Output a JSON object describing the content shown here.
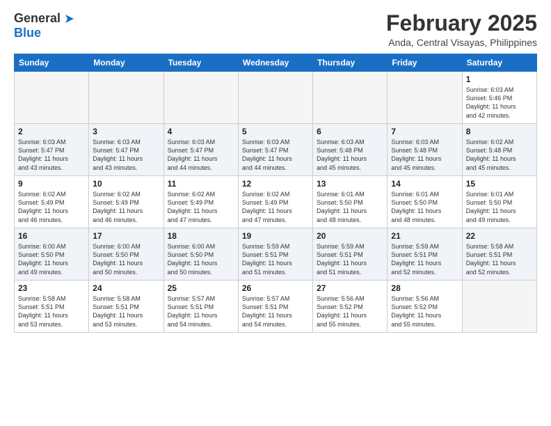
{
  "header": {
    "logo_general": "General",
    "logo_blue": "Blue",
    "month": "February 2025",
    "location": "Anda, Central Visayas, Philippines"
  },
  "weekdays": [
    "Sunday",
    "Monday",
    "Tuesday",
    "Wednesday",
    "Thursday",
    "Friday",
    "Saturday"
  ],
  "weeks": [
    [
      {
        "day": "",
        "info": ""
      },
      {
        "day": "",
        "info": ""
      },
      {
        "day": "",
        "info": ""
      },
      {
        "day": "",
        "info": ""
      },
      {
        "day": "",
        "info": ""
      },
      {
        "day": "",
        "info": ""
      },
      {
        "day": "1",
        "info": "Sunrise: 6:03 AM\nSunset: 5:46 PM\nDaylight: 11 hours\nand 42 minutes."
      }
    ],
    [
      {
        "day": "2",
        "info": "Sunrise: 6:03 AM\nSunset: 5:47 PM\nDaylight: 11 hours\nand 43 minutes."
      },
      {
        "day": "3",
        "info": "Sunrise: 6:03 AM\nSunset: 5:47 PM\nDaylight: 11 hours\nand 43 minutes."
      },
      {
        "day": "4",
        "info": "Sunrise: 6:03 AM\nSunset: 5:47 PM\nDaylight: 11 hours\nand 44 minutes."
      },
      {
        "day": "5",
        "info": "Sunrise: 6:03 AM\nSunset: 5:47 PM\nDaylight: 11 hours\nand 44 minutes."
      },
      {
        "day": "6",
        "info": "Sunrise: 6:03 AM\nSunset: 5:48 PM\nDaylight: 11 hours\nand 45 minutes."
      },
      {
        "day": "7",
        "info": "Sunrise: 6:03 AM\nSunset: 5:48 PM\nDaylight: 11 hours\nand 45 minutes."
      },
      {
        "day": "8",
        "info": "Sunrise: 6:02 AM\nSunset: 5:48 PM\nDaylight: 11 hours\nand 45 minutes."
      }
    ],
    [
      {
        "day": "9",
        "info": "Sunrise: 6:02 AM\nSunset: 5:49 PM\nDaylight: 11 hours\nand 46 minutes."
      },
      {
        "day": "10",
        "info": "Sunrise: 6:02 AM\nSunset: 5:49 PM\nDaylight: 11 hours\nand 46 minutes."
      },
      {
        "day": "11",
        "info": "Sunrise: 6:02 AM\nSunset: 5:49 PM\nDaylight: 11 hours\nand 47 minutes."
      },
      {
        "day": "12",
        "info": "Sunrise: 6:02 AM\nSunset: 5:49 PM\nDaylight: 11 hours\nand 47 minutes."
      },
      {
        "day": "13",
        "info": "Sunrise: 6:01 AM\nSunset: 5:50 PM\nDaylight: 11 hours\nand 48 minutes."
      },
      {
        "day": "14",
        "info": "Sunrise: 6:01 AM\nSunset: 5:50 PM\nDaylight: 11 hours\nand 48 minutes."
      },
      {
        "day": "15",
        "info": "Sunrise: 6:01 AM\nSunset: 5:50 PM\nDaylight: 11 hours\nand 49 minutes."
      }
    ],
    [
      {
        "day": "16",
        "info": "Sunrise: 6:00 AM\nSunset: 5:50 PM\nDaylight: 11 hours\nand 49 minutes."
      },
      {
        "day": "17",
        "info": "Sunrise: 6:00 AM\nSunset: 5:50 PM\nDaylight: 11 hours\nand 50 minutes."
      },
      {
        "day": "18",
        "info": "Sunrise: 6:00 AM\nSunset: 5:50 PM\nDaylight: 11 hours\nand 50 minutes."
      },
      {
        "day": "19",
        "info": "Sunrise: 5:59 AM\nSunset: 5:51 PM\nDaylight: 11 hours\nand 51 minutes."
      },
      {
        "day": "20",
        "info": "Sunrise: 5:59 AM\nSunset: 5:51 PM\nDaylight: 11 hours\nand 51 minutes."
      },
      {
        "day": "21",
        "info": "Sunrise: 5:59 AM\nSunset: 5:51 PM\nDaylight: 11 hours\nand 52 minutes."
      },
      {
        "day": "22",
        "info": "Sunrise: 5:58 AM\nSunset: 5:51 PM\nDaylight: 11 hours\nand 52 minutes."
      }
    ],
    [
      {
        "day": "23",
        "info": "Sunrise: 5:58 AM\nSunset: 5:51 PM\nDaylight: 11 hours\nand 53 minutes."
      },
      {
        "day": "24",
        "info": "Sunrise: 5:58 AM\nSunset: 5:51 PM\nDaylight: 11 hours\nand 53 minutes."
      },
      {
        "day": "25",
        "info": "Sunrise: 5:57 AM\nSunset: 5:51 PM\nDaylight: 11 hours\nand 54 minutes."
      },
      {
        "day": "26",
        "info": "Sunrise: 5:57 AM\nSunset: 5:51 PM\nDaylight: 11 hours\nand 54 minutes."
      },
      {
        "day": "27",
        "info": "Sunrise: 5:56 AM\nSunset: 5:52 PM\nDaylight: 11 hours\nand 55 minutes."
      },
      {
        "day": "28",
        "info": "Sunrise: 5:56 AM\nSunset: 5:52 PM\nDaylight: 11 hours\nand 55 minutes."
      },
      {
        "day": "",
        "info": ""
      }
    ]
  ]
}
